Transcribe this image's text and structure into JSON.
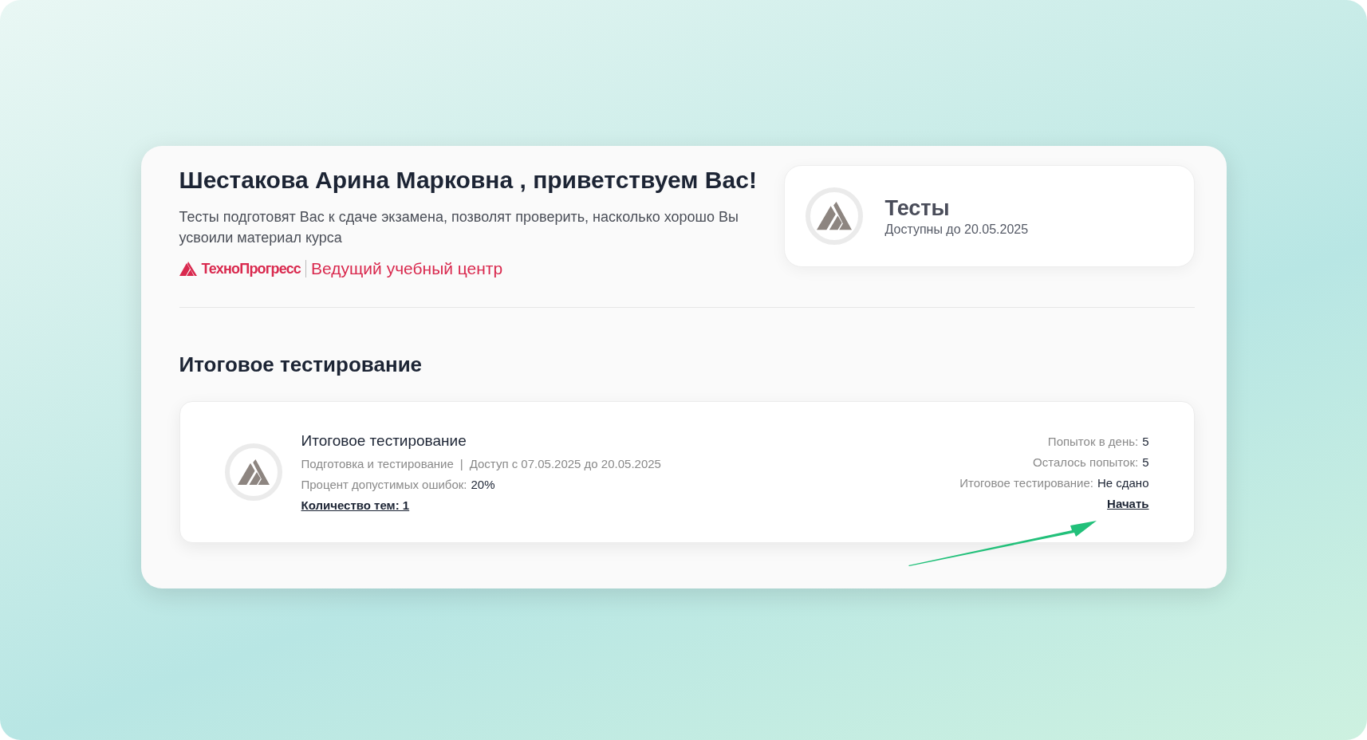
{
  "greeting": {
    "title": "Шестакова Арина Марковна , приветствуем Вас!",
    "description": "Тесты подготовят Вас к сдаче экзамена, позволят проверить, насколько хорошо Вы усвоили материал курса",
    "brand": "ТехноПрогресс",
    "brand_tagline": "Ведущий учебный центр"
  },
  "tests_card": {
    "title": "Тесты",
    "subtitle": "Доступны до 20.05.2025"
  },
  "section_title": "Итоговое тестирование",
  "test_item": {
    "title": "Итоговое тестирование",
    "category": "Подготовка и тестирование",
    "separator": "|",
    "access": "Доступ с 07.05.2025 до 20.05.2025",
    "error_label": "Процент допустимых ошибок:",
    "error_value": "20%",
    "topics_link": "Количество тем: 1",
    "stats": [
      {
        "label": "Попыток в день:",
        "value": "5"
      },
      {
        "label": "Осталось попыток:",
        "value": "5"
      },
      {
        "label": "Итоговое тестирование:",
        "value": "Не сдано"
      }
    ],
    "start_link": "Начать"
  }
}
